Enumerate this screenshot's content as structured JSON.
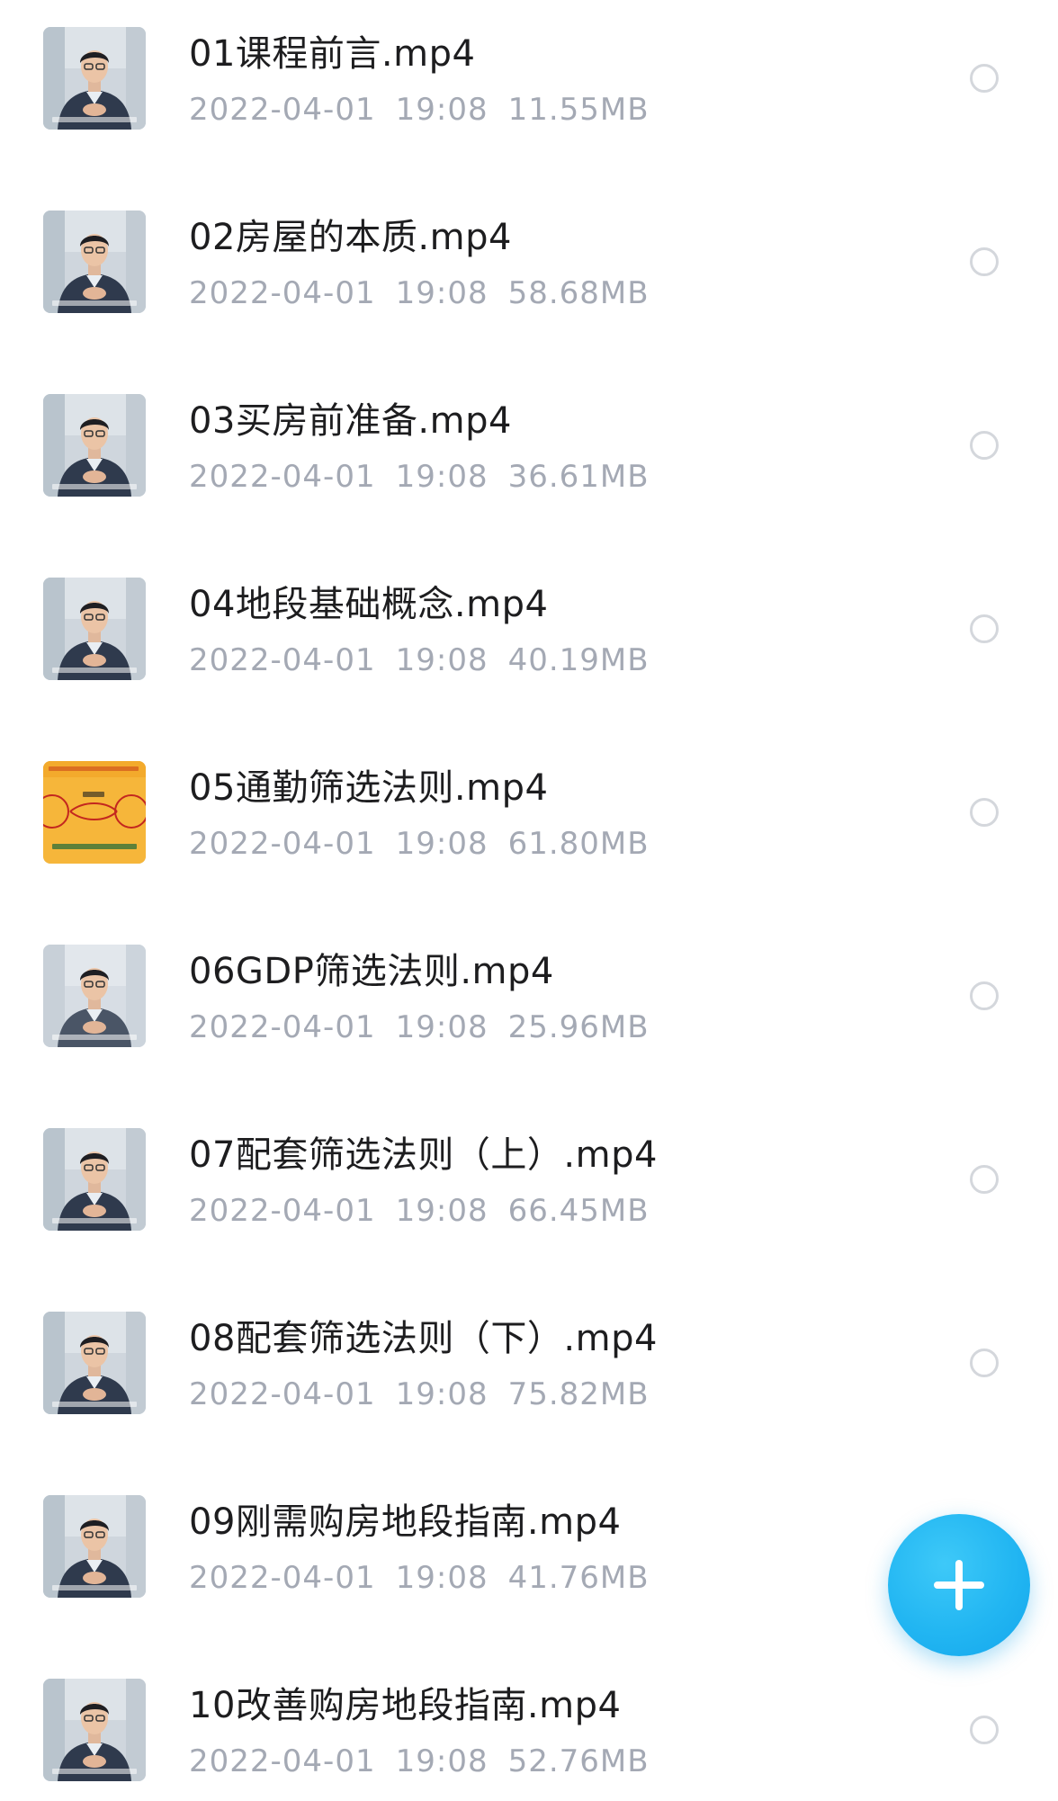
{
  "colors": {
    "title": "#1d1d1f",
    "meta": "#a4a9b4",
    "radio_border": "#d4d7dc",
    "fab": "#22b6f2",
    "thumb_orange": "#f6b63a"
  },
  "files": [
    {
      "name": "01课程前言.mp4",
      "date": "2022-04-01",
      "time": "19:08",
      "size": "11.55MB",
      "thumb": "video-thumb-speaker"
    },
    {
      "name": "02房屋的本质.mp4",
      "date": "2022-04-01",
      "time": "19:08",
      "size": "58.68MB",
      "thumb": "video-thumb-speaker"
    },
    {
      "name": "03买房前准备.mp4",
      "date": "2022-04-01",
      "time": "19:08",
      "size": "36.61MB",
      "thumb": "video-thumb-speaker"
    },
    {
      "name": "04地段基础概念.mp4",
      "date": "2022-04-01",
      "time": "19:08",
      "size": "40.19MB",
      "thumb": "video-thumb-speaker"
    },
    {
      "name": "05通勤筛选法则.mp4",
      "date": "2022-04-01",
      "time": "19:08",
      "size": "61.80MB",
      "thumb": "video-thumb-diagram"
    },
    {
      "name": "06GDP筛选法则.mp4",
      "date": "2022-04-01",
      "time": "19:08",
      "size": "25.96MB",
      "thumb": "video-thumb-speaker-blurred"
    },
    {
      "name": "07配套筛选法则（上）.mp4",
      "date": "2022-04-01",
      "time": "19:08",
      "size": "66.45MB",
      "thumb": "video-thumb-speaker"
    },
    {
      "name": "08配套筛选法则（下）.mp4",
      "date": "2022-04-01",
      "time": "19:08",
      "size": "75.82MB",
      "thumb": "video-thumb-speaker"
    },
    {
      "name": "09刚需购房地段指南.mp4",
      "date": "2022-04-01",
      "time": "19:08",
      "size": "41.76MB",
      "thumb": "video-thumb-speaker"
    },
    {
      "name": "10改善购房地段指南.mp4",
      "date": "2022-04-01",
      "time": "19:08",
      "size": "52.76MB",
      "thumb": "video-thumb-speaker"
    }
  ],
  "fab": {
    "icon": "plus-icon"
  }
}
